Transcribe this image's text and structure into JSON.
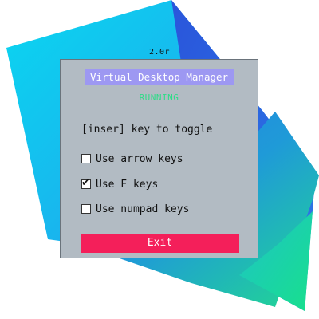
{
  "app": {
    "version": "2.0r",
    "title": "Virtual Desktop Manager",
    "status": "RUNNING"
  },
  "hint": "[inser] key to toggle",
  "options": [
    {
      "label": "Use arrow keys",
      "checked": false
    },
    {
      "label": "Use F keys",
      "checked": true
    },
    {
      "label": "Use numpad keys",
      "checked": false
    }
  ],
  "exit_button": {
    "label": "Exit"
  },
  "colors": {
    "panel_bg": "#b2bbc3",
    "title_bg": "#9d98f2",
    "status_text": "#2edc88",
    "exit_bg": "#f41f5a"
  }
}
